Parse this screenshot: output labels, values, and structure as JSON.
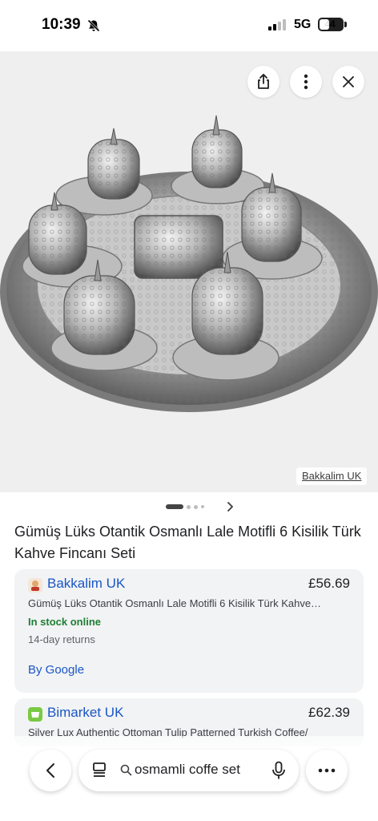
{
  "status_bar": {
    "time": "10:39",
    "network": "5G",
    "battery": "44",
    "battery_level": 0.44
  },
  "image_viewer": {
    "source_label": "Bakkalim UK",
    "carousel": {
      "count": 4,
      "active_index": 0
    }
  },
  "product": {
    "title": "Gümüş Lüks Otantik Osmanlı Lale Motifli 6 Kisilik Türk Kahve Fincanı Seti"
  },
  "offers": [
    {
      "store": "Bakkalim UK",
      "price": "£56.69",
      "description": "Gümüş Lüks Otantik Osmanlı Lale Motifli 6 Kisilik Türk Kahve…",
      "stock": "In stock online",
      "returns": "14-day returns",
      "by": "By Google",
      "icon": "bakkalim-favicon",
      "accent": "#1a55c7"
    },
    {
      "store": "Bimarket UK",
      "price": "£62.39",
      "description": "Silver Lux Authentic Ottoman Tulip Patterned Turkish Coffee/",
      "icon": "bimarket-favicon",
      "accent": "#1a55c7"
    }
  ],
  "search": {
    "query": "osmamli coffe set"
  },
  "icons": {
    "share": "share-icon",
    "more": "more-vert-icon",
    "close": "close-icon",
    "back": "back-arrow-icon",
    "lens": "google-lens-icon",
    "search": "search-icon",
    "mic": "mic-icon",
    "menu": "more-horiz-icon"
  }
}
